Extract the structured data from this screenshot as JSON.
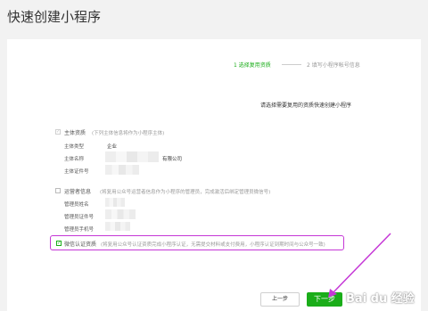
{
  "page": {
    "title": "快速创建小程序"
  },
  "steps": {
    "step1": "1 选择复用资质",
    "step2": "2 填写小程序帐号信息"
  },
  "instruction": "请选择需要复用的资质快速创建小程序",
  "subject": {
    "label": "主体资质",
    "note": "(下列主体信息将作为小程序主体)",
    "rows": [
      {
        "label": "主体类型",
        "value": "企业"
      },
      {
        "label": "主体名称",
        "value": "有限公司"
      },
      {
        "label": "主体证件号",
        "value": ""
      }
    ]
  },
  "admin": {
    "label": "运营者信息",
    "note": "(将复用公众号运营者信息作为小程序的管理员，完成激活后绑定管理员微信号)",
    "rows": [
      {
        "label": "管理员姓名",
        "value": ""
      },
      {
        "label": "管理员证件号",
        "value": ""
      },
      {
        "label": "管理员手机号",
        "value": ""
      }
    ]
  },
  "wechat_cert": {
    "label": "微信认证资质",
    "note": "(将复用公众号认证资质完成小程序认证，无需提交材料或支付费用，小程序认证到期时间与公众号一致)"
  },
  "buttons": {
    "prev": "上一步",
    "next": "下一步"
  },
  "watermark": "Bai du 经验",
  "colors": {
    "accent": "#1aad19",
    "highlight": "#c537d6"
  }
}
